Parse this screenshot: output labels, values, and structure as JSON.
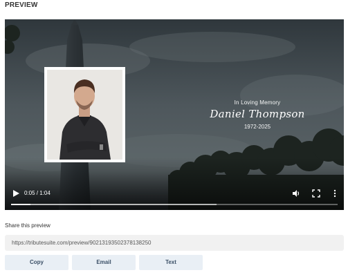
{
  "preview": {
    "title": "PREVIEW"
  },
  "video": {
    "memorial_line": "In Loving Memory",
    "name": "Daniel Thompson",
    "years": "1972-2025",
    "time_display": "0:05 / 1:04",
    "progress_played": 0.06,
    "progress_buffered": 0.63,
    "icons": [
      "play-icon",
      "volume-icon",
      "fullscreen-icon",
      "more-options-icon"
    ]
  },
  "share": {
    "label": "Share this preview",
    "url": "https://tributesuite.com/preview/90213193502378138250",
    "buttons": {
      "copy": "Copy",
      "email": "Email",
      "text": "Text"
    }
  }
}
